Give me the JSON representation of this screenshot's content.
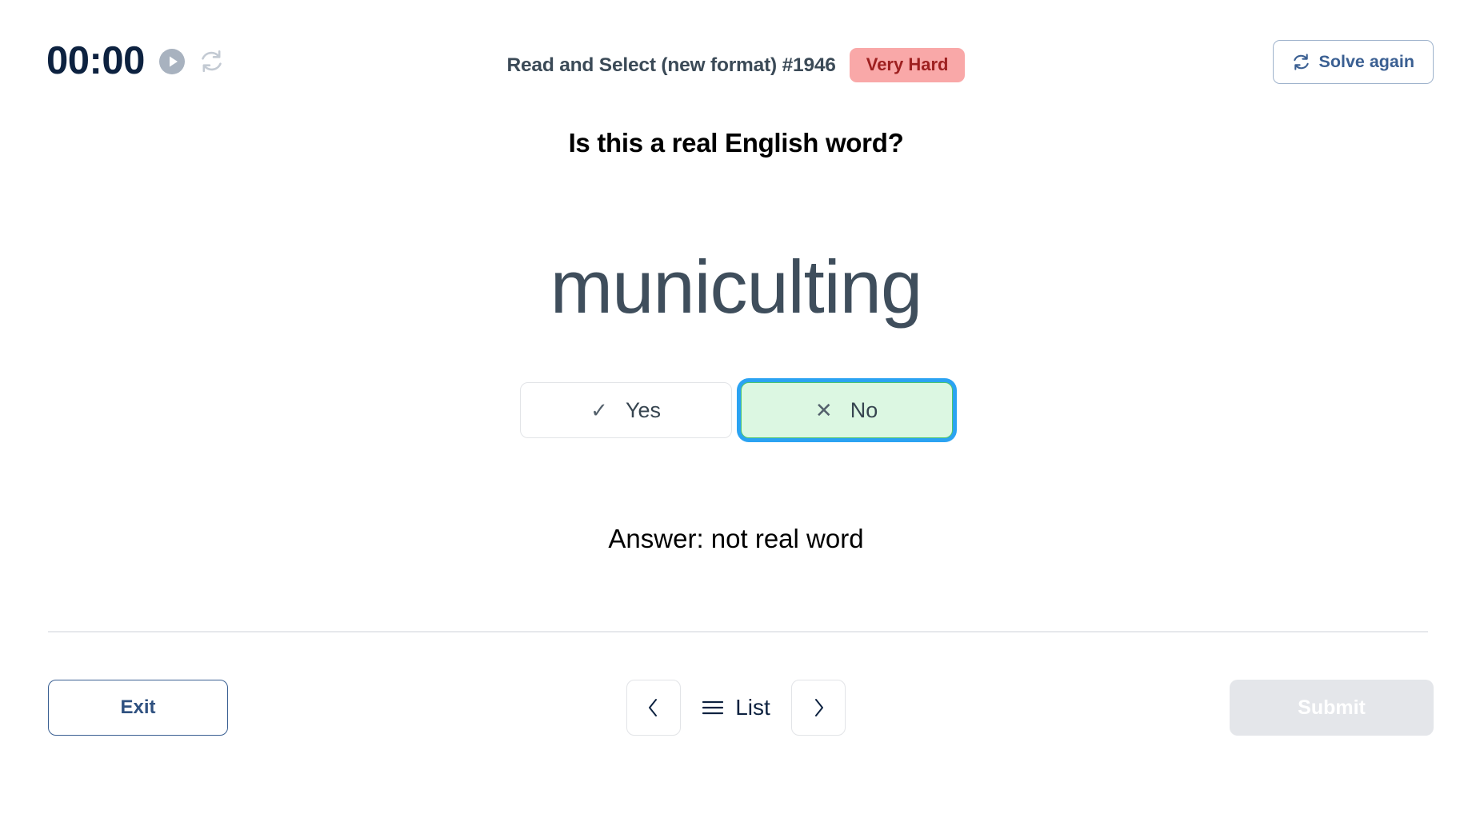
{
  "header": {
    "timer": "00:00",
    "play_icon": "play-circle-icon",
    "reset_icon": "reset-circle-icon",
    "quiz_title": "Read and Select (new format) #1946",
    "difficulty": "Very Hard",
    "difficulty_bg": "#f9a8a8",
    "difficulty_color": "#9e2020",
    "solve_again_label": "Solve again",
    "solve_again_icon": "refresh-icon"
  },
  "main": {
    "question": "Is this a real English word?",
    "word": "municulting",
    "choices": [
      {
        "id": "yes",
        "mark": "✓",
        "label": "Yes",
        "selected": false
      },
      {
        "id": "no",
        "mark": "✕",
        "label": "No",
        "selected": true
      }
    ],
    "answer": "Answer: not real word",
    "selected_bg": "#dcf7e2",
    "selected_border": "#4ec56c",
    "focus_ring": "#2ba3f2"
  },
  "footer": {
    "exit_label": "Exit",
    "prev_icon": "chevron-left-icon",
    "list_icon": "hamburger-icon",
    "list_label": "List",
    "next_icon": "chevron-right-icon",
    "submit_label": "Submit",
    "submit_disabled_bg": "#e4e6ea"
  }
}
